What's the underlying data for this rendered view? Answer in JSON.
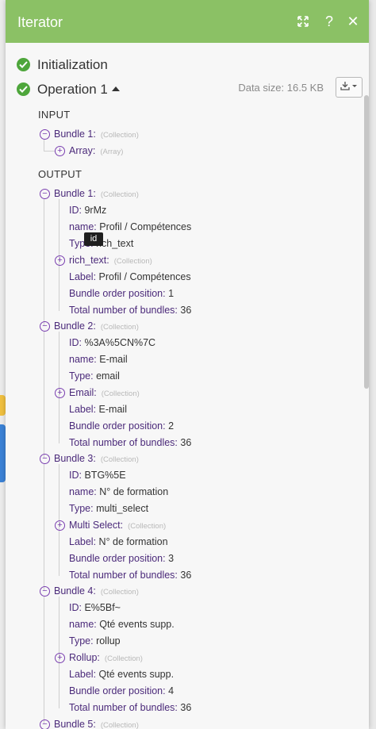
{
  "header": {
    "title": "Iterator"
  },
  "operations": {
    "initialization": "Initialization",
    "operation1": "Operation 1",
    "data_size": "Data size: 16.5 KB"
  },
  "input": {
    "label": "INPUT",
    "bundle_label": "Bundle 1:",
    "bundle_type": "(Collection)",
    "array_label": "Array:",
    "array_type": "(Array)"
  },
  "output": {
    "label": "OUTPUT",
    "bundles": [
      {
        "name": "Bundle 1:",
        "type": "(Collection)",
        "id": "9rMz",
        "field_name": "Profil / Compétences",
        "field_type": "rich_text",
        "item_key": "rich_text:",
        "item_type": "(Collection)",
        "label": "Profil / Compétences",
        "position": "1",
        "total": "36"
      },
      {
        "name": "Bundle 2:",
        "type": "(Collection)",
        "id": "%3A%5CN%7C",
        "field_name": "E-mail",
        "field_type": "email",
        "item_key": "Email:",
        "item_type": "(Collection)",
        "label": "E-mail",
        "position": "2",
        "total": "36"
      },
      {
        "name": "Bundle 3:",
        "type": "(Collection)",
        "id": "BTG%5E",
        "field_name": "N° de formation",
        "field_type": "multi_select",
        "item_key": "Multi Select:",
        "item_type": "(Collection)",
        "label": "N° de formation",
        "position": "3",
        "total": "36"
      },
      {
        "name": "Bundle 4:",
        "type": "(Collection)",
        "id": "E%5Bf~",
        "field_name": "Qté events supp.",
        "field_type": "rollup",
        "item_key": "Rollup:",
        "item_type": "(Collection)",
        "label": "Qté events supp.",
        "position": "4",
        "total": "36"
      },
      {
        "name": "Bundle 5:",
        "type": "(Collection)"
      }
    ]
  },
  "keys": {
    "id": "ID:",
    "name": "name:",
    "type": "Type:",
    "label": "Label:",
    "position": "Bundle order position:",
    "total": "Total number of bundles:"
  },
  "tooltip": "id",
  "colors": {
    "header": "#8bc165",
    "check": "#4ea63b",
    "key": "#4b2a7a",
    "toggle": "#7a3fb0"
  }
}
